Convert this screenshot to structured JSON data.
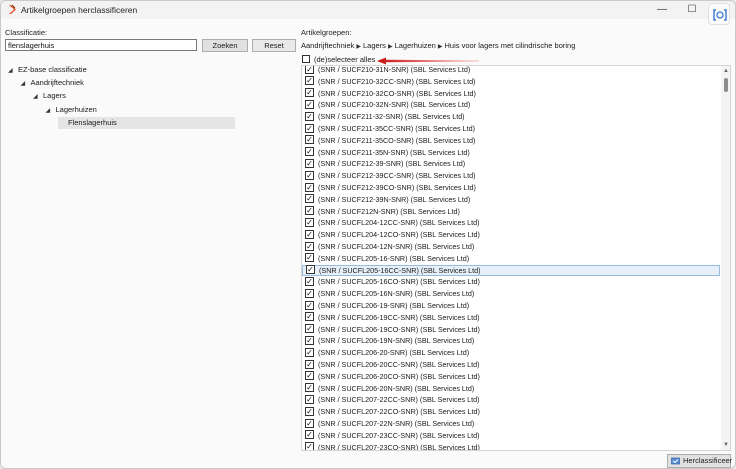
{
  "window": {
    "title": "Artikelgroepen herclassificeren",
    "controls": {
      "minimize": "—",
      "maximize": "☐",
      "close": "✕"
    }
  },
  "left": {
    "label": "Classificatie:",
    "search_value": "flenslagerhuis",
    "zoeken_label": "Zoeken",
    "reset_label": "Reset",
    "tree": [
      {
        "label": "EZ-base classificatie",
        "level": 0,
        "expanded": true,
        "selected": false
      },
      {
        "label": "Aandrijftechniek",
        "level": 1,
        "expanded": true,
        "selected": false
      },
      {
        "label": "Lagers",
        "level": 2,
        "expanded": true,
        "selected": false
      },
      {
        "label": "Lagerhuizen",
        "level": 3,
        "expanded": true,
        "selected": false
      },
      {
        "label": "Flenslagerhuis",
        "level": 4,
        "expanded": false,
        "selected": true
      }
    ]
  },
  "right": {
    "label": "Artikelgroepen:",
    "breadcrumb": [
      "Aandrijftechniek",
      "Lagers",
      "Lagerhuizen",
      "Huis voor lagers met cilindrische boring"
    ],
    "select_all_label": "(de)selecteer alles",
    "select_all_checked": false,
    "items": [
      {
        "label": "(SNR / SUCF210-31N-SNR) (SBL Services Ltd)",
        "checked": true,
        "highlight": false
      },
      {
        "label": "(SNR / SUCF210-32CC-SNR) (SBL Services Ltd)",
        "checked": true,
        "highlight": false
      },
      {
        "label": "(SNR / SUCF210-32CO-SNR) (SBL Services Ltd)",
        "checked": true,
        "highlight": false
      },
      {
        "label": "(SNR / SUCF210-32N-SNR) (SBL Services Ltd)",
        "checked": true,
        "highlight": false
      },
      {
        "label": "(SNR / SUCF211-32-SNR) (SBL Services Ltd)",
        "checked": true,
        "highlight": false
      },
      {
        "label": "(SNR / SUCF211-35CC-SNR) (SBL Services Ltd)",
        "checked": true,
        "highlight": false
      },
      {
        "label": "(SNR / SUCF211-35CO-SNR) (SBL Services Ltd)",
        "checked": true,
        "highlight": false
      },
      {
        "label": "(SNR / SUCF211-35N-SNR) (SBL Services Ltd)",
        "checked": true,
        "highlight": false
      },
      {
        "label": "(SNR / SUCF212-39-SNR) (SBL Services Ltd)",
        "checked": true,
        "highlight": false
      },
      {
        "label": "(SNR / SUCF212-39CC-SNR) (SBL Services Ltd)",
        "checked": true,
        "highlight": false
      },
      {
        "label": "(SNR / SUCF212-39CO-SNR) (SBL Services Ltd)",
        "checked": true,
        "highlight": false
      },
      {
        "label": "(SNR / SUCF212-39N-SNR) (SBL Services Ltd)",
        "checked": true,
        "highlight": false
      },
      {
        "label": "(SNR / SUCF212N-SNR) (SBL Services Ltd)",
        "checked": true,
        "highlight": false
      },
      {
        "label": "(SNR / SUCFL204-12CC-SNR) (SBL Services Ltd)",
        "checked": true,
        "highlight": false
      },
      {
        "label": "(SNR / SUCFL204-12CO-SNR) (SBL Services Ltd)",
        "checked": true,
        "highlight": false
      },
      {
        "label": "(SNR / SUCFL204-12N-SNR) (SBL Services Ltd)",
        "checked": true,
        "highlight": false
      },
      {
        "label": "(SNR / SUCFL205-16-SNR) (SBL Services Ltd)",
        "checked": true,
        "highlight": false
      },
      {
        "label": "(SNR / SUCFL205-16CC-SNR) (SBL Services Ltd)",
        "checked": true,
        "highlight": true
      },
      {
        "label": "(SNR / SUCFL205-16CO-SNR) (SBL Services Ltd)",
        "checked": true,
        "highlight": false
      },
      {
        "label": "(SNR / SUCFL205-16N-SNR) (SBL Services Ltd)",
        "checked": true,
        "highlight": false
      },
      {
        "label": "(SNR / SUCFL206-19-SNR) (SBL Services Ltd)",
        "checked": true,
        "highlight": false
      },
      {
        "label": "(SNR / SUCFL206-19CC-SNR) (SBL Services Ltd)",
        "checked": true,
        "highlight": false
      },
      {
        "label": "(SNR / SUCFL206-19CO-SNR) (SBL Services Ltd)",
        "checked": true,
        "highlight": false
      },
      {
        "label": "(SNR / SUCFL206-19N-SNR) (SBL Services Ltd)",
        "checked": true,
        "highlight": false
      },
      {
        "label": "(SNR / SUCFL206-20-SNR) (SBL Services Ltd)",
        "checked": true,
        "highlight": false
      },
      {
        "label": "(SNR / SUCFL206-20CC-SNR) (SBL Services Ltd)",
        "checked": true,
        "highlight": false
      },
      {
        "label": "(SNR / SUCFL206-20CO-SNR) (SBL Services Ltd)",
        "checked": true,
        "highlight": false
      },
      {
        "label": "(SNR / SUCFL206-20N-SNR) (SBL Services Ltd)",
        "checked": true,
        "highlight": false
      },
      {
        "label": "(SNR / SUCFL207-22CC-SNR) (SBL Services Ltd)",
        "checked": true,
        "highlight": false
      },
      {
        "label": "(SNR / SUCFL207-22CO-SNR) (SBL Services Ltd)",
        "checked": true,
        "highlight": false
      },
      {
        "label": "(SNR / SUCFL207-22N-SNR) (SBL Services Ltd)",
        "checked": true,
        "highlight": false
      },
      {
        "label": "(SNR / SUCFL207-23CC-SNR) (SBL Services Ltd)",
        "checked": true,
        "highlight": false
      },
      {
        "label": "(SNR / SUCFL207-23CO-SNR) (SBL Services Ltd)",
        "checked": true,
        "highlight": false
      }
    ]
  },
  "footer": {
    "herclassificeer_label": "Herclassificeer"
  },
  "colors": {
    "annotation_arrow": "#e31b1b",
    "highlight_row": "#e7f0f8"
  },
  "icons": [
    "app-logo-icon",
    "minimize-icon",
    "maximize-icon",
    "close-icon",
    "extension-icon",
    "tree-expand-arrow-icon",
    "breadcrumb-arrow-icon",
    "checkbox-icon",
    "scroll-up-icon",
    "scroll-down-icon",
    "herclassificeer-icon",
    "red-arrow-annotation"
  ]
}
